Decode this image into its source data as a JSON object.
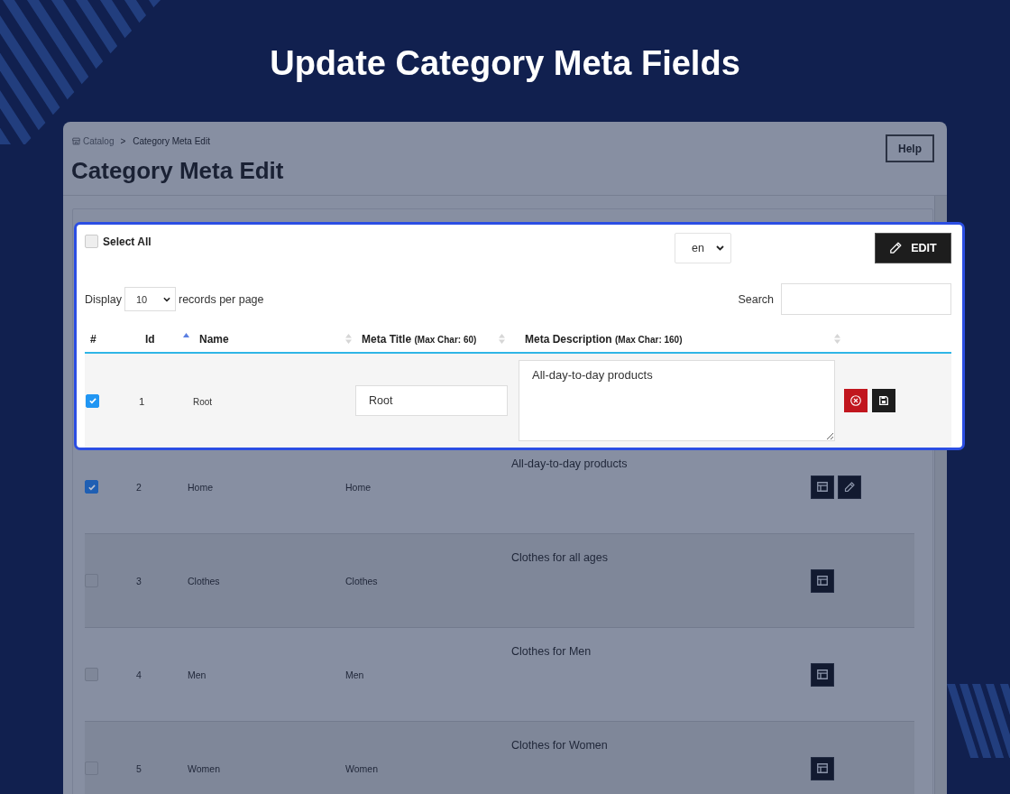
{
  "heading": "Update Category Meta Fields",
  "breadcrumb": {
    "items": [
      {
        "label": "Catalog"
      },
      {
        "label": "Category Meta Edit"
      }
    ],
    "separator": ">"
  },
  "page_title": "Category Meta Edit",
  "help_button": {
    "label": "Help"
  },
  "editor": {
    "select_all": {
      "label": "Select All",
      "checked": false
    },
    "language": {
      "value": "en"
    },
    "edit_button": {
      "label": "EDIT"
    },
    "page_size": {
      "prefix": "Display",
      "value": "10",
      "suffix": "records per page"
    },
    "search": {
      "label": "Search"
    },
    "columns": [
      {
        "label": "#"
      },
      {
        "label": "Id",
        "sorted": true
      },
      {
        "label": "Name",
        "sorted": false
      },
      {
        "label": "Meta Title",
        "note": "(Max Char: 60)",
        "sorted": false
      },
      {
        "label": "Meta Description",
        "note": "(Max Char: 160)",
        "sorted": false
      }
    ],
    "row": {
      "checked": true,
      "id": "1",
      "name": "Root",
      "meta_title": "Root",
      "meta_description": "All-day-to-day products",
      "actions": [
        {
          "kind": "cancel"
        },
        {
          "kind": "save"
        }
      ]
    }
  },
  "rows": [
    {
      "checked": true,
      "id": "2",
      "name": "Home",
      "meta_title": "Home",
      "meta_description": "All-day-to-day products",
      "actions": [
        {
          "kind": "layout"
        },
        {
          "kind": "edit"
        }
      ]
    },
    {
      "checked": false,
      "id": "3",
      "name": "Clothes",
      "meta_title": "Clothes",
      "meta_description": "Clothes for all ages",
      "actions": [
        {
          "kind": "layout"
        }
      ]
    },
    {
      "checked": false,
      "id": "4",
      "name": "Men",
      "meta_title": "Men",
      "meta_description": "Clothes for Men",
      "actions": [
        {
          "kind": "layout"
        }
      ]
    },
    {
      "checked": false,
      "id": "5",
      "name": "Women",
      "meta_title": "Women",
      "meta_description": "Clothes for Women",
      "actions": [
        {
          "kind": "layout"
        }
      ]
    }
  ]
}
